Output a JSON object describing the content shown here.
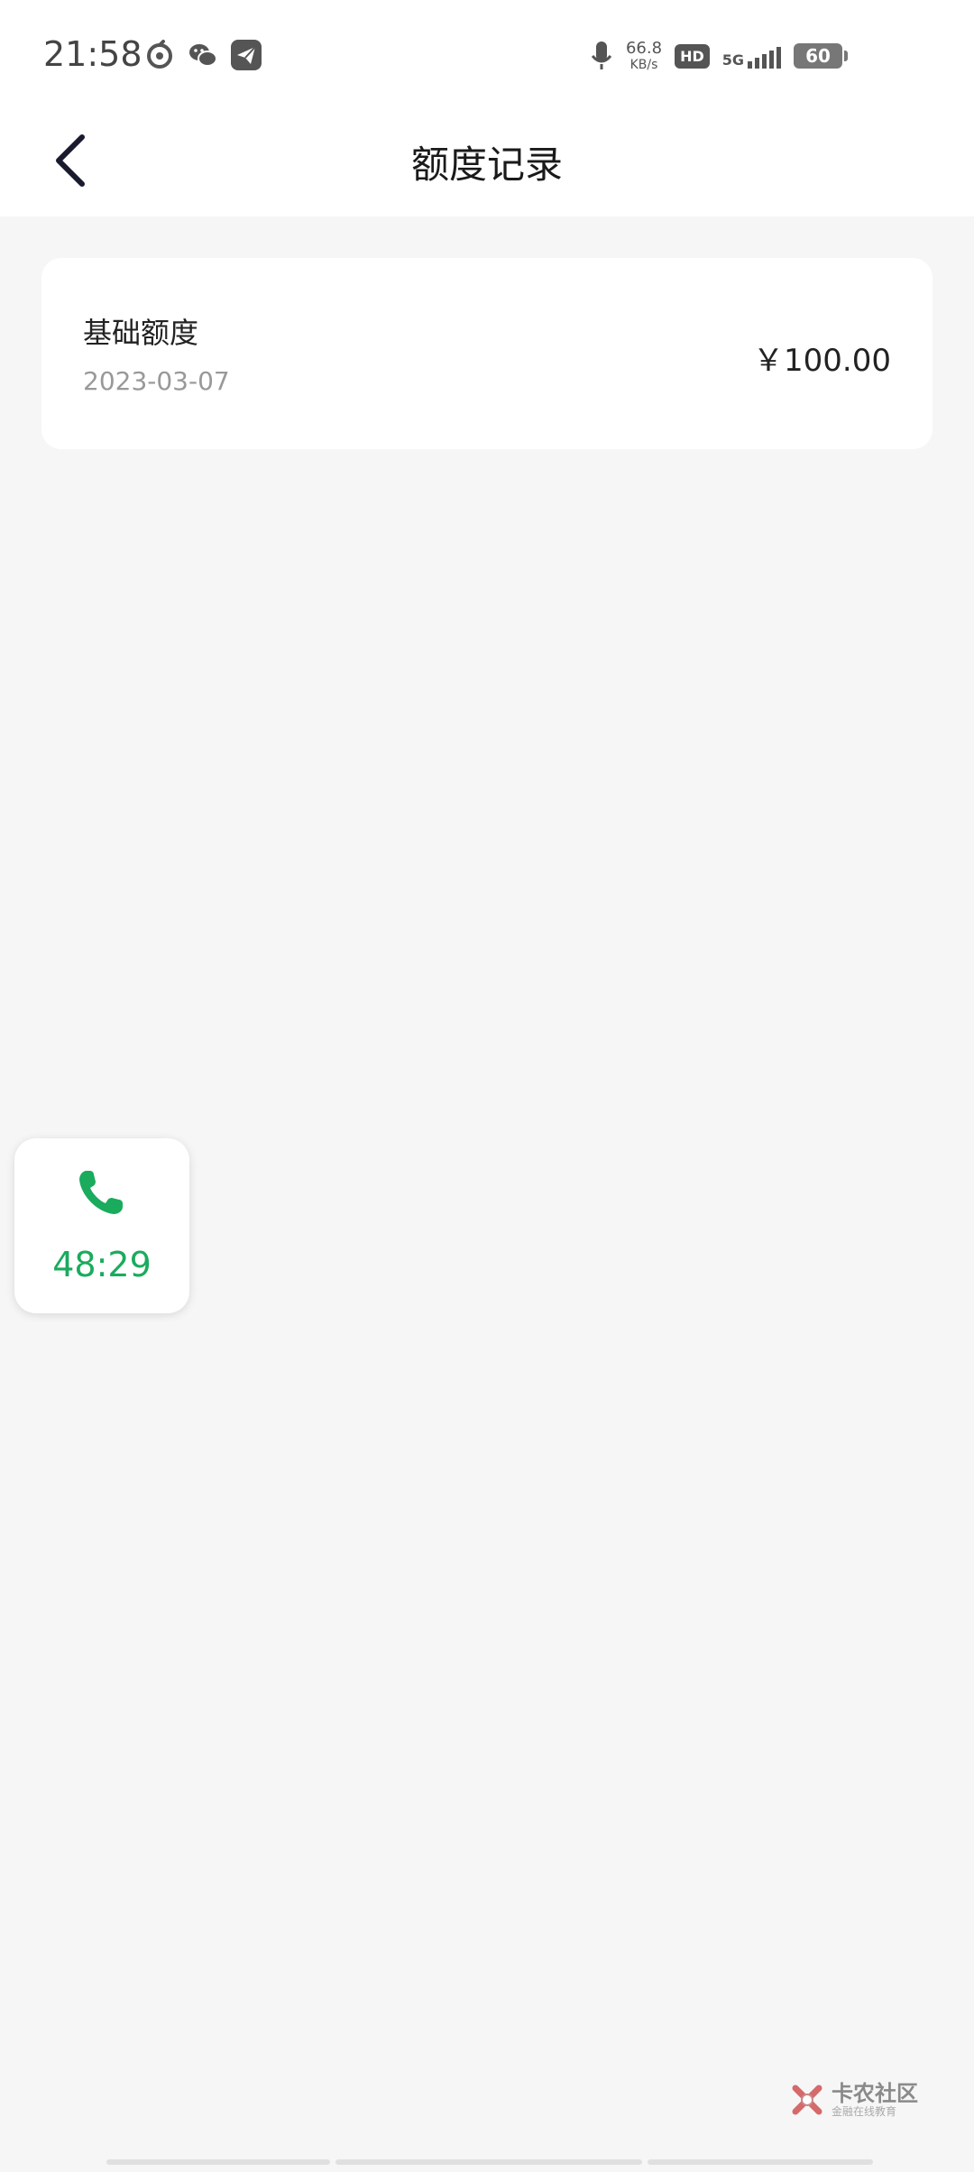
{
  "status_bar": {
    "time": "21:58",
    "net_speed_value": "66.8",
    "net_speed_unit": "KB/s",
    "hd_label": "HD",
    "network_type": "5G",
    "battery_level": "60",
    "left_icons": [
      "netease-music-icon",
      "wechat-icon",
      "telegram-icon"
    ]
  },
  "header": {
    "title": "额度记录"
  },
  "records": [
    {
      "title": "基础额度",
      "date": "2023-03-07",
      "amount": "￥100.00"
    }
  ],
  "call_widget": {
    "timer": "48:29",
    "accent_color": "#1aab5d"
  },
  "watermark": {
    "title": "卡农社区",
    "subtitle": "金融在线教育"
  }
}
